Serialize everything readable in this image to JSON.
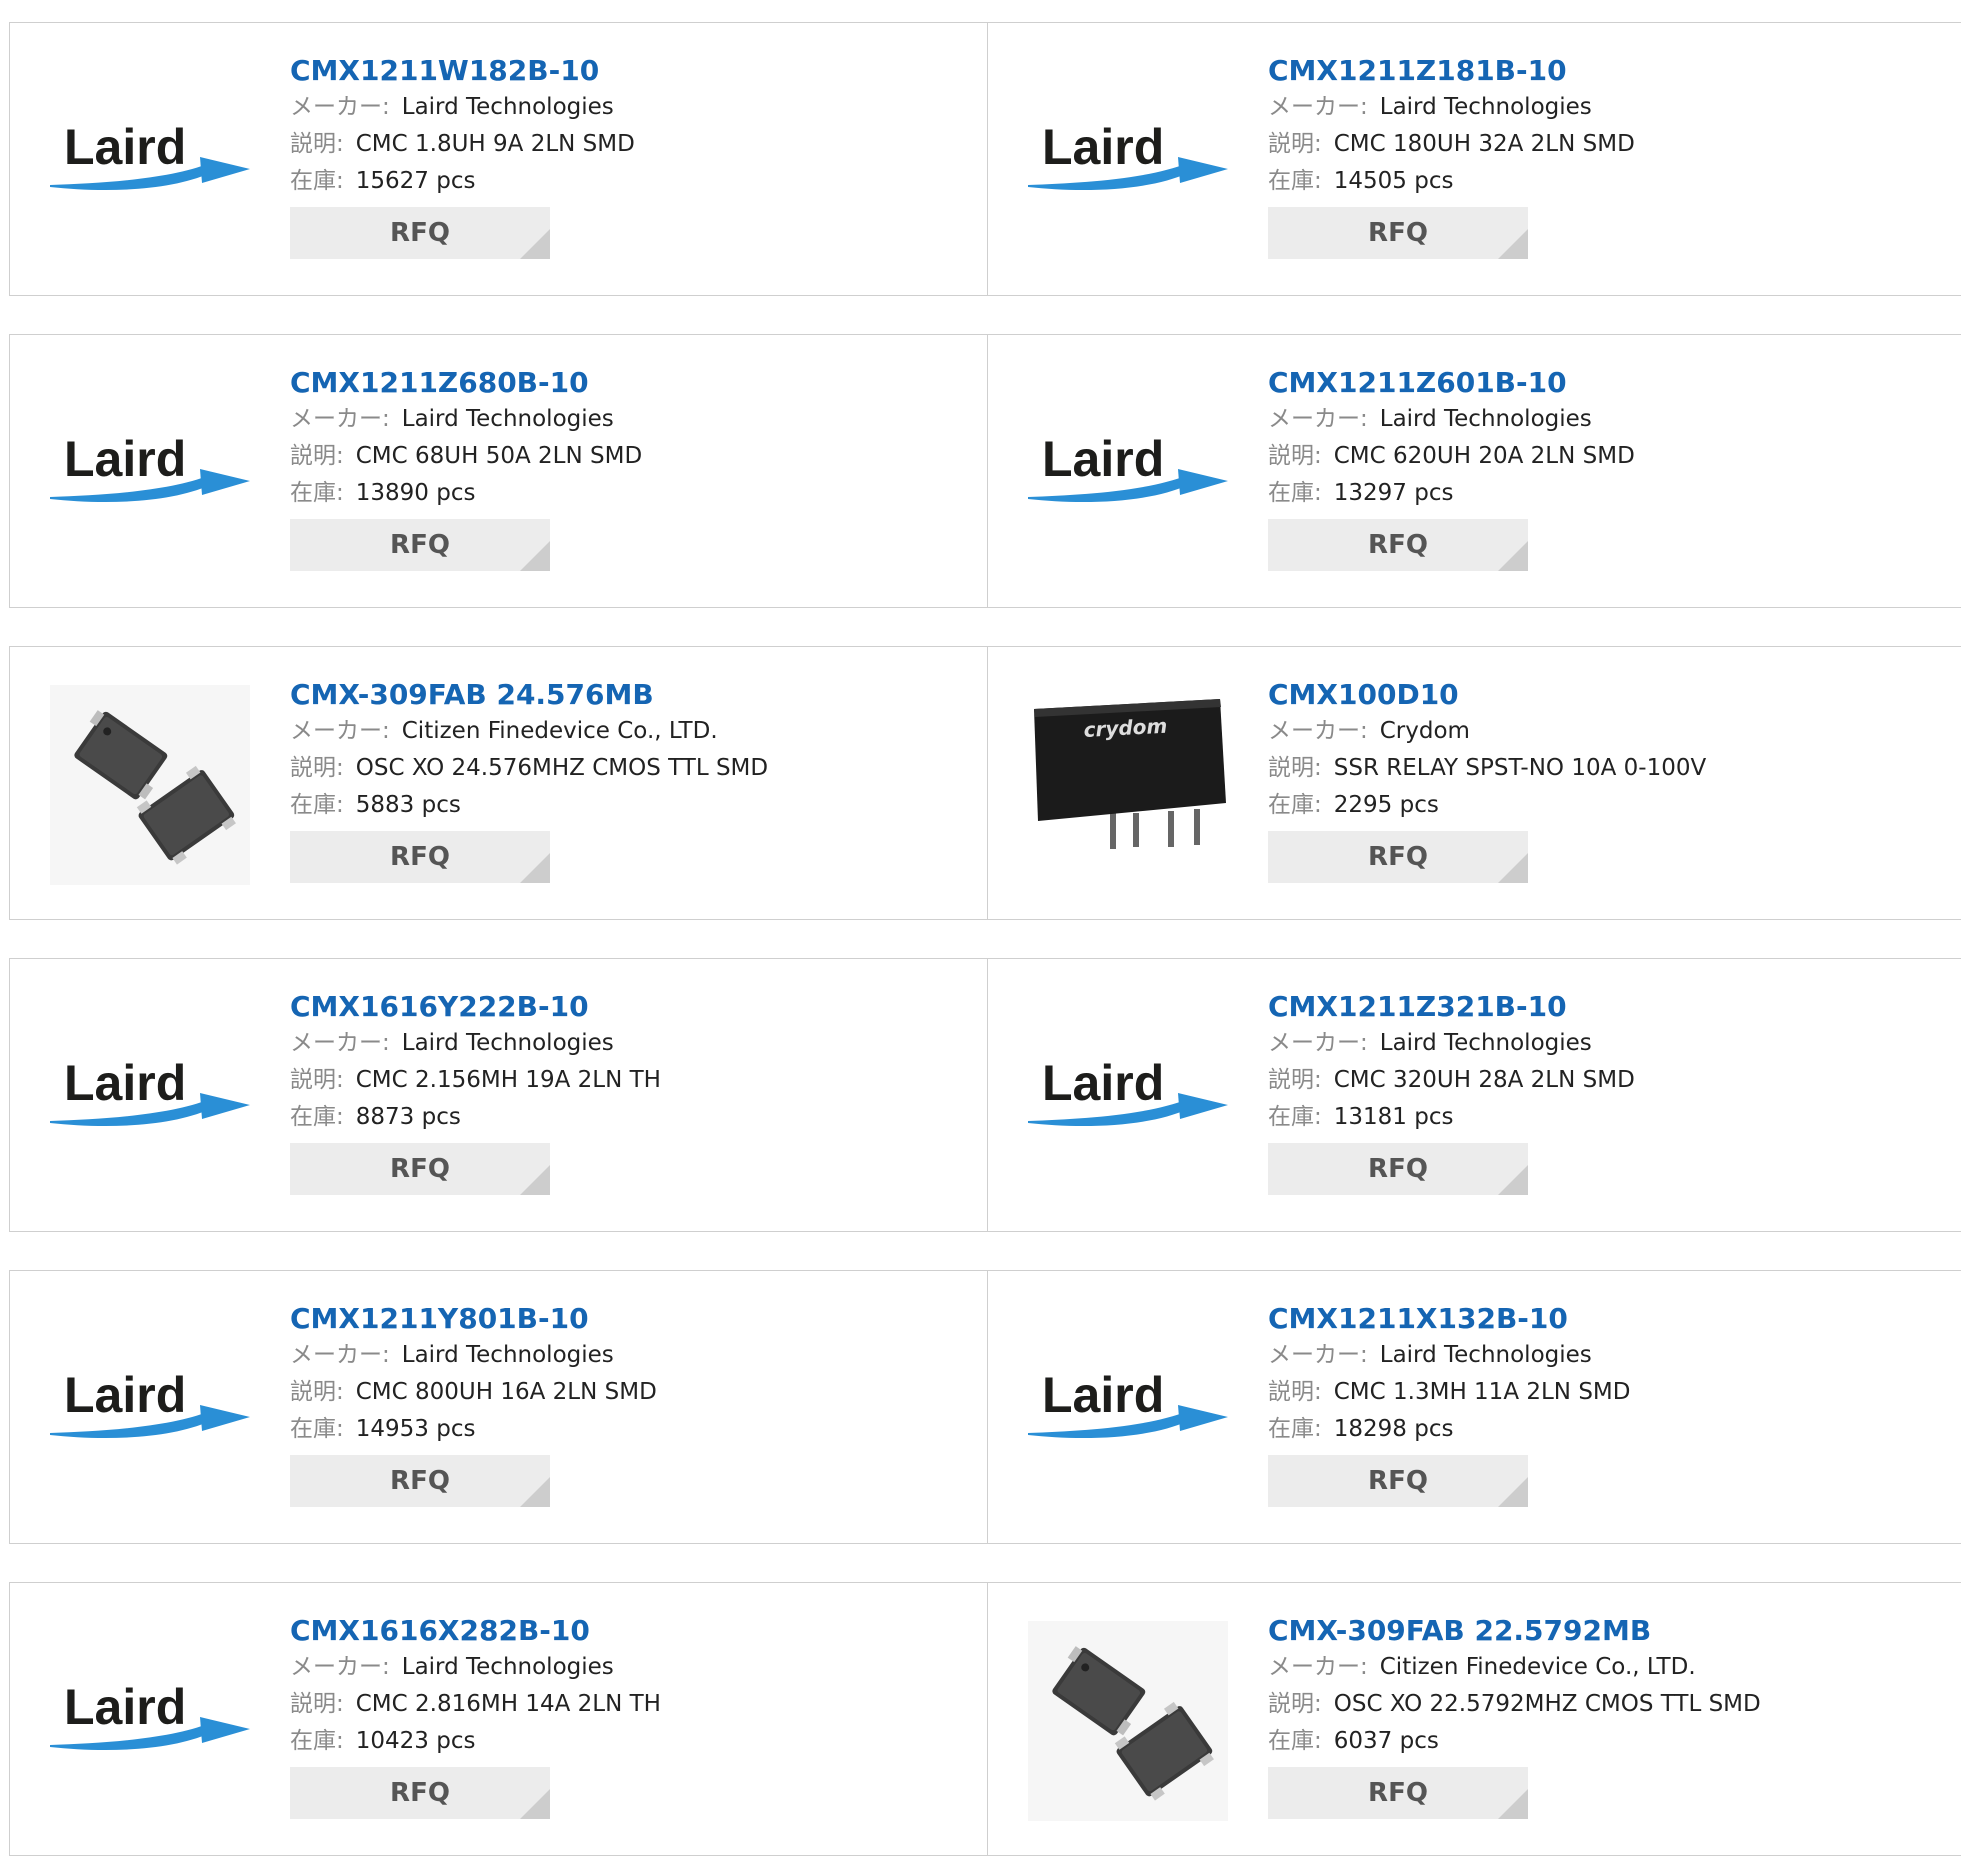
{
  "labels": {
    "maker": "メーカー:",
    "desc": "説明:",
    "stock": "在庫:",
    "rfq": "RFQ"
  },
  "products": [
    {
      "pn": "CMX1211W182B-10",
      "maker": "Laird Technologies",
      "desc": "CMC 1.8UH 9A 2LN SMD",
      "stock": "15627 pcs",
      "image": "laird-logo"
    },
    {
      "pn": "CMX1211Z181B-10",
      "maker": "Laird Technologies",
      "desc": "CMC 180UH 32A 2LN SMD",
      "stock": "14505 pcs",
      "image": "laird-logo"
    },
    {
      "pn": "CMX1211Z680B-10",
      "maker": "Laird Technologies",
      "desc": "CMC 68UH 50A 2LN SMD",
      "stock": "13890 pcs",
      "image": "laird-logo"
    },
    {
      "pn": "CMX1211Z601B-10",
      "maker": "Laird Technologies",
      "desc": "CMC 620UH 20A 2LN SMD",
      "stock": "13297 pcs",
      "image": "laird-logo"
    },
    {
      "pn": "CMX-309FAB 24.576MB",
      "maker": "Citizen Finedevice Co., LTD.",
      "desc": "OSC XO 24.576MHZ CMOS TTL SMD",
      "stock": "5883 pcs",
      "image": "oscillator-photo"
    },
    {
      "pn": "CMX100D10",
      "maker": "Crydom",
      "desc": "SSR RELAY SPST-NO 10A 0-100V",
      "stock": "2295 pcs",
      "image": "crydom-relay-photo",
      "brand_text": "crydom"
    },
    {
      "pn": "CMX1616Y222B-10",
      "maker": "Laird Technologies",
      "desc": "CMC 2.156MH 19A 2LN TH",
      "stock": "8873 pcs",
      "image": "laird-logo"
    },
    {
      "pn": "CMX1211Z321B-10",
      "maker": "Laird Technologies",
      "desc": "CMC 320UH 28A 2LN SMD",
      "stock": "13181 pcs",
      "image": "laird-logo"
    },
    {
      "pn": "CMX1211Y801B-10",
      "maker": "Laird Technologies",
      "desc": "CMC 800UH 16A 2LN SMD",
      "stock": "14953 pcs",
      "image": "laird-logo"
    },
    {
      "pn": "CMX1211X132B-10",
      "maker": "Laird Technologies",
      "desc": "CMC 1.3MH 11A 2LN SMD",
      "stock": "18298 pcs",
      "image": "laird-logo"
    },
    {
      "pn": "CMX1616X282B-10",
      "maker": "Laird Technologies",
      "desc": "CMC 2.816MH 14A 2LN TH",
      "stock": "10423 pcs",
      "image": "laird-logo"
    },
    {
      "pn": "CMX-309FAB 22.5792MB",
      "maker": "Citizen Finedevice Co., LTD.",
      "desc": "OSC XO 22.5792MHZ CMOS TTL SMD",
      "stock": "6037 pcs",
      "image": "oscillator-photo"
    }
  ],
  "colors": {
    "link": "#1565b3",
    "border": "#cfcfcf",
    "label": "#8a8a8a",
    "button_bg": "#ececec",
    "button_corner": "#cdcdcd",
    "laird_blue": "#2a8fd6"
  }
}
